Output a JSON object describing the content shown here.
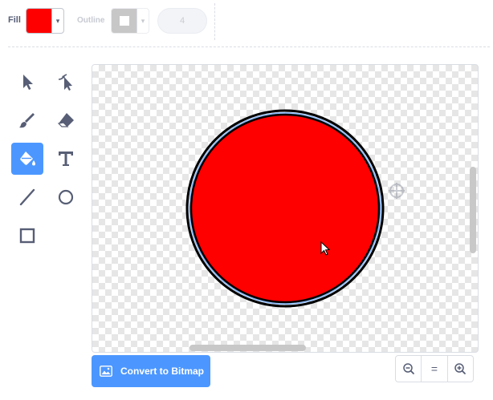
{
  "toolbar": {
    "fill_label": "Fill",
    "fill_color": "#ff0000",
    "outline_label": "Outline",
    "outline_color": "#9a9a9a",
    "outline_width": "4",
    "dropdown_glyph": "▾"
  },
  "tools": [
    {
      "name": "select-tool",
      "icon": "arrow-pointer-icon",
      "active": false
    },
    {
      "name": "reshape-tool",
      "icon": "reshape-pointer-icon",
      "active": false
    },
    {
      "name": "brush-tool",
      "icon": "brush-icon",
      "active": false
    },
    {
      "name": "eraser-tool",
      "icon": "eraser-icon",
      "active": false
    },
    {
      "name": "fill-tool",
      "icon": "paint-bucket-icon",
      "active": true
    },
    {
      "name": "text-tool",
      "icon": "text-t-icon",
      "active": false
    },
    {
      "name": "line-tool",
      "icon": "line-icon",
      "active": false
    },
    {
      "name": "circle-tool",
      "icon": "circle-icon",
      "active": false
    },
    {
      "name": "rectangle-tool",
      "icon": "rectangle-icon",
      "active": false
    }
  ],
  "canvas": {
    "shape_fill": "#ff0000",
    "shape_stroke": "#000000",
    "shape_highlight": "#4c97ff"
  },
  "bottom": {
    "convert_label": "Convert to Bitmap",
    "zoom_reset_glyph": "="
  },
  "colors": {
    "accent": "#4c97ff",
    "text": "#575e75"
  }
}
